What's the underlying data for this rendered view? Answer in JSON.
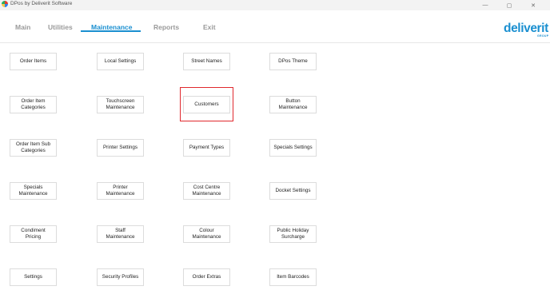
{
  "window": {
    "title": "DPos by Deliverit Software",
    "minimize_glyph": "—",
    "maximize_glyph": "▢",
    "close_glyph": "✕"
  },
  "menu": {
    "tabs": [
      {
        "label": "Main",
        "active": false
      },
      {
        "label": "Utilities",
        "active": false
      },
      {
        "label": "Maintenance",
        "active": true
      },
      {
        "label": "Reports",
        "active": false
      },
      {
        "label": "Exit",
        "active": false
      }
    ],
    "accent_color": "#1a8fd0",
    "inactive_color": "#9a9a9a"
  },
  "brand": {
    "logo_text": "deliverit",
    "sub_text": "GROUP"
  },
  "buttons": {
    "order_items": "Order Items",
    "local_settings": "Local Settings",
    "street_names": "Street Names",
    "dpos_theme": "DPos Theme",
    "order_item_categories": [
      "Order Item",
      "Categories"
    ],
    "touchscreen_maintenance": [
      "Touchscreen",
      "Maintenance"
    ],
    "customers": "Customers",
    "button_maintenance": [
      "Button",
      "Maintenance"
    ],
    "order_item_sub_categories": [
      "Order Item Sub",
      "Categories"
    ],
    "printer_settings": "Printer Settings",
    "payment_types": "Payment Types",
    "specials_settings": "Specials Settings",
    "specials_maintenance": [
      "Specials",
      "Maintenance"
    ],
    "printer_maintenance": [
      "Printer",
      "Maintenance"
    ],
    "cost_centre_maintenance": [
      "Cost Centre",
      "Maintenance"
    ],
    "docket_settings": "Docket Settings",
    "condiment_pricing": [
      "Condiment",
      "Pricing"
    ],
    "staff_maintenance": [
      "Staff",
      "Maintenance"
    ],
    "colour_maintenance": [
      "Colour",
      "Maintenance"
    ],
    "public_holiday_surcharge": [
      "Public Holiday",
      "Surcharge"
    ],
    "settings": "Settings",
    "security_profiles": "Security Profiles",
    "order_extras": "Order Extras",
    "item_barcodes": "Item Barcodes"
  },
  "highlight_color": "#e0282d"
}
